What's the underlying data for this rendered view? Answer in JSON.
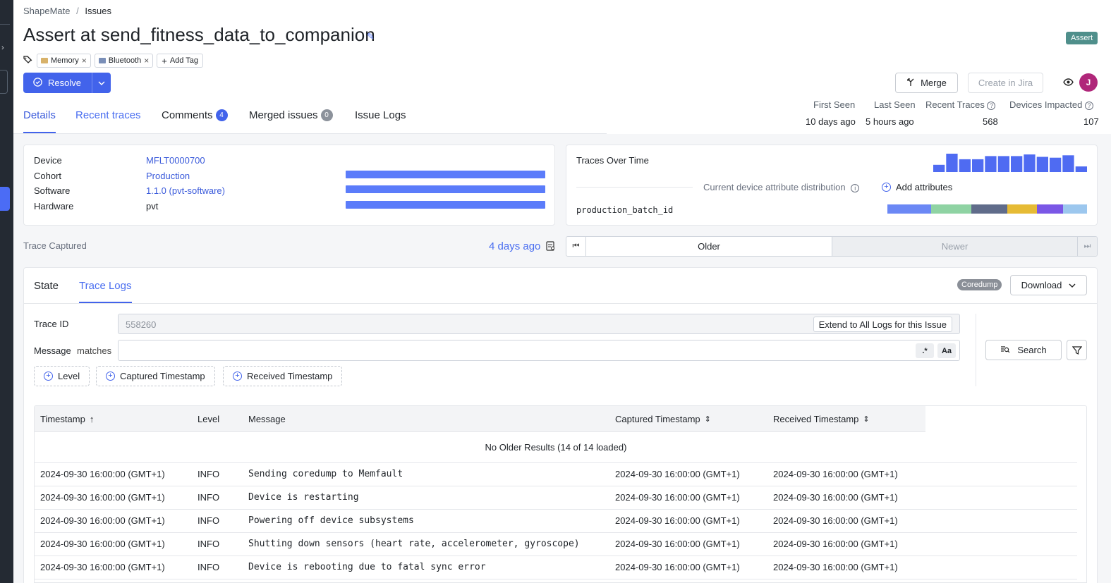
{
  "breadcrumb": {
    "root": "ShapeMate",
    "sep": "/",
    "current": "Issues"
  },
  "issue": {
    "title": "Assert at send_fitness_data_to_companion",
    "type_badge": "Assert",
    "tags": [
      {
        "label": "Memory",
        "color": "#d8b26a"
      },
      {
        "label": "Bluetooth",
        "color": "#7a8fb8"
      }
    ],
    "add_tag_label": "Add Tag"
  },
  "actions": {
    "resolve_label": "Resolve",
    "merge_label": "Merge",
    "jira_label": "Create in Jira",
    "avatar_initial": "J"
  },
  "tabs": [
    {
      "label": "Details"
    },
    {
      "label": "Recent traces"
    },
    {
      "label": "Comments",
      "count": "4"
    },
    {
      "label": "Merged issues",
      "count": "0"
    },
    {
      "label": "Issue Logs"
    }
  ],
  "stats": {
    "first_seen": {
      "label": "First Seen",
      "value": "10 days ago"
    },
    "last_seen": {
      "label": "Last Seen",
      "value": "5 hours ago"
    },
    "recent_traces": {
      "label": "Recent Traces",
      "value": "568"
    },
    "devices_impacted": {
      "label": "Devices Impacted",
      "value": "107"
    }
  },
  "details": {
    "rows": [
      {
        "key": "Device",
        "value": "MFLT0000700"
      },
      {
        "key": "Cohort",
        "value": "Production"
      },
      {
        "key": "Software",
        "value": "1.1.0 (pvt-software)"
      },
      {
        "key": "Hardware",
        "value": "pvt"
      }
    ],
    "bar_fractions": [
      1.0,
      1.0,
      1.0
    ]
  },
  "traces_panel": {
    "title": "Traces Over Time",
    "distribution_label": "Current device attribute distribution",
    "add_attributes_label": "Add attributes",
    "attribute_name": "production_batch_id",
    "attribute_segments": [
      {
        "fraction": 0.22,
        "color": "#6b88f5"
      },
      {
        "fraction": 0.2,
        "color": "#8fd3a3"
      },
      {
        "fraction": 0.18,
        "color": "#606c8a"
      },
      {
        "fraction": 0.15,
        "color": "#e6bb35"
      },
      {
        "fraction": 0.13,
        "color": "#7a57e6"
      },
      {
        "fraction": 0.12,
        "color": "#9cc7ee"
      }
    ]
  },
  "chart_data": {
    "type": "bar",
    "title": "Traces Over Time",
    "values": [
      9,
      23,
      16,
      16,
      20,
      20,
      20,
      22,
      19,
      18,
      21,
      7
    ],
    "color": "#4f6bf2"
  },
  "trace_nav": {
    "label": "Trace Captured",
    "time": "4 days ago",
    "older_label": "Older",
    "newer_label": "Newer"
  },
  "logs": {
    "subtabs": [
      {
        "label": "State"
      },
      {
        "label": "Trace Logs"
      }
    ],
    "coredump_badge": "Coredump",
    "download_label": "Download",
    "trace_id_label": "Trace ID",
    "trace_id_value": "558260",
    "extend_label": "Extend to All Logs for this Issue",
    "message_label": "Message",
    "matches_label": "matches",
    "regex_btn": ".*",
    "case_btn": "Aa",
    "search_label": "Search",
    "filter_chips": [
      "Level",
      "Captured Timestamp",
      "Received Timestamp"
    ],
    "columns": [
      "Timestamp",
      "Level",
      "Message",
      "Captured Timestamp",
      "Received Timestamp"
    ],
    "no_older_text": "No Older Results (14 of 14 loaded)",
    "rows": [
      {
        "timestamp": "2024-09-30 16:00:00 (GMT+1)",
        "level": "INFO",
        "message": "Sending coredump to Memfault",
        "captured": "2024-09-30 16:00:00 (GMT+1)",
        "received": "2024-09-30 16:00:00 (GMT+1)"
      },
      {
        "timestamp": "2024-09-30 16:00:00 (GMT+1)",
        "level": "INFO",
        "message": "Device is restarting",
        "captured": "2024-09-30 16:00:00 (GMT+1)",
        "received": "2024-09-30 16:00:00 (GMT+1)"
      },
      {
        "timestamp": "2024-09-30 16:00:00 (GMT+1)",
        "level": "INFO",
        "message": "Powering off device subsystems",
        "captured": "2024-09-30 16:00:00 (GMT+1)",
        "received": "2024-09-30 16:00:00 (GMT+1)"
      },
      {
        "timestamp": "2024-09-30 16:00:00 (GMT+1)",
        "level": "INFO",
        "message": "Shutting down sensors (heart rate, accelerometer, gyroscope)",
        "captured": "2024-09-30 16:00:00 (GMT+1)",
        "received": "2024-09-30 16:00:00 (GMT+1)"
      },
      {
        "timestamp": "2024-09-30 16:00:00 (GMT+1)",
        "level": "INFO",
        "message": "Device is rebooting due to fatal sync error",
        "captured": "2024-09-30 16:00:00 (GMT+1)",
        "received": "2024-09-30 16:00:00 (GMT+1)"
      }
    ]
  }
}
